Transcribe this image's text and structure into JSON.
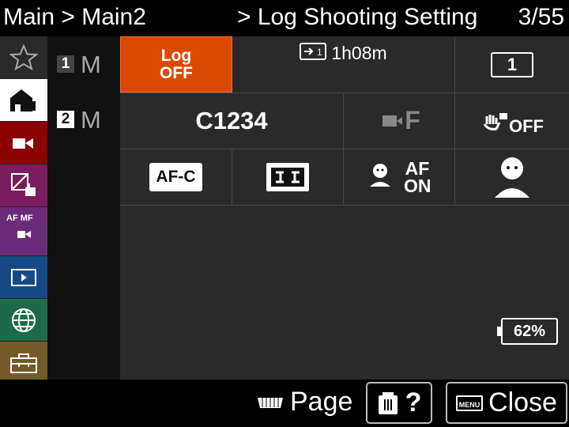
{
  "header": {
    "crumb": "Main > Main2",
    "setting": "> Log Shooting Setting",
    "page": "3/55"
  },
  "tabs": [
    {
      "name": "tab-star",
      "icon": "star-icon"
    },
    {
      "name": "tab-home",
      "icon": "home-icon"
    },
    {
      "name": "tab-movie",
      "icon": "movie-icon"
    },
    {
      "name": "tab-exposure",
      "icon": "exposure-icon"
    },
    {
      "name": "tab-af-mf",
      "icon": "af-mf-icon",
      "label": "AF MF"
    },
    {
      "name": "tab-playback",
      "icon": "playback-icon"
    },
    {
      "name": "tab-network",
      "icon": "globe-icon"
    },
    {
      "name": "tab-setup",
      "icon": "toolbox-icon"
    }
  ],
  "sub": [
    {
      "num": "1",
      "label": "M"
    },
    {
      "num": "2",
      "label": "M"
    }
  ],
  "panel": {
    "log": {
      "line1": "Log",
      "line2": "OFF"
    },
    "record_time": "1h08m",
    "slot": "1",
    "profile": "C1234",
    "movie_frame": "F",
    "stabilizer": "OFF",
    "af_mode": "AF-C",
    "focus_area": "[:]",
    "face_af": "AF ON",
    "face_icon": "face-icon",
    "battery": "62%"
  },
  "bottom": {
    "page": "Page",
    "help": "?",
    "close": "Close",
    "menu": "MENU"
  }
}
